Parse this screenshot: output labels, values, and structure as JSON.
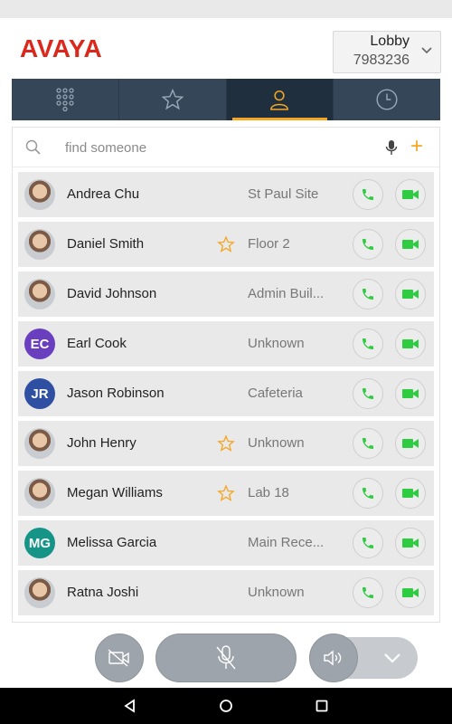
{
  "header": {
    "logo_text": "AVAYA",
    "lobby_name": "Lobby",
    "lobby_extension": "7983236"
  },
  "tabs": [
    {
      "icon": "dialpad-icon",
      "active": false
    },
    {
      "icon": "star-icon",
      "active": false
    },
    {
      "icon": "person-icon",
      "active": true
    },
    {
      "icon": "clock-icon",
      "active": false
    }
  ],
  "search": {
    "placeholder": "find someone",
    "value": ""
  },
  "contacts": [
    {
      "name": "Andrea Chu",
      "location": "St Paul Site",
      "favorite": false,
      "initials": "",
      "avatar_color": ""
    },
    {
      "name": "Daniel Smith",
      "location": "Floor 2",
      "favorite": true,
      "initials": "",
      "avatar_color": ""
    },
    {
      "name": "David Johnson",
      "location": "Admin Buil...",
      "favorite": false,
      "initials": "",
      "avatar_color": ""
    },
    {
      "name": "Earl Cook",
      "location": "Unknown",
      "favorite": false,
      "initials": "EC",
      "avatar_color": "#6a3fbf"
    },
    {
      "name": "Jason Robinson",
      "location": "Cafeteria",
      "favorite": false,
      "initials": "JR",
      "avatar_color": "#2f4fa2"
    },
    {
      "name": "John Henry",
      "location": "Unknown",
      "favorite": true,
      "initials": "",
      "avatar_color": ""
    },
    {
      "name": "Megan Williams",
      "location": "Lab 18",
      "favorite": true,
      "initials": "",
      "avatar_color": ""
    },
    {
      "name": "Melissa Garcia",
      "location": "Main Rece...",
      "favorite": false,
      "initials": "MG",
      "avatar_color": "#159488"
    },
    {
      "name": "Ratna Joshi",
      "location": "Unknown",
      "favorite": false,
      "initials": "",
      "avatar_color": ""
    }
  ],
  "colors": {
    "brand": "#da291c",
    "accent": "#f5a623",
    "call_green": "#2ecc40",
    "tab_bg": "#344657"
  }
}
